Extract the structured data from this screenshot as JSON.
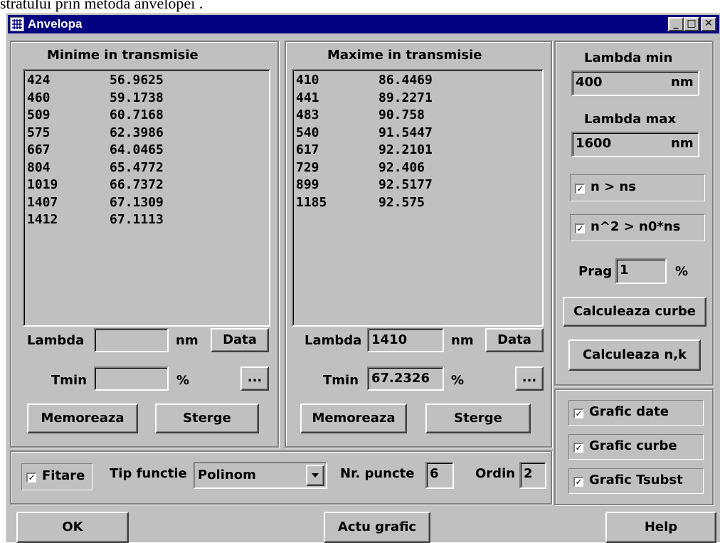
{
  "doc_caption": "stratului prin metoda anvelopei   .",
  "window": {
    "title": "Anvelopa",
    "min_icon": "minimize-icon",
    "max_icon": "maximize-icon",
    "close_icon": "close-icon"
  },
  "min_panel": {
    "title": "Minime in transmisie",
    "rows": [
      [
        "424",
        "56.9625"
      ],
      [
        "460",
        "59.1738"
      ],
      [
        "509",
        "60.7168"
      ],
      [
        "575",
        "62.3986"
      ],
      [
        "667",
        "64.0465"
      ],
      [
        "804",
        "65.4772"
      ],
      [
        "1019",
        "66.7372"
      ],
      [
        "1407",
        "67.1309"
      ],
      [
        "1412",
        "67.1113"
      ]
    ],
    "lambda_label": "Lambda",
    "lambda_value": "",
    "nm": "nm",
    "data_btn": "Data",
    "t_label": "Tmin",
    "t_value": "",
    "pct": "%",
    "more_btn": "...",
    "save_btn": "Memoreaza",
    "delete_btn": "Sterge"
  },
  "max_panel": {
    "title": "Maxime in transmisie",
    "rows": [
      [
        "410",
        "86.4469"
      ],
      [
        "441",
        "89.2271"
      ],
      [
        "483",
        "90.758"
      ],
      [
        "540",
        "91.5447"
      ],
      [
        "617",
        "92.2101"
      ],
      [
        "729",
        "92.406"
      ],
      [
        "899",
        "92.5177"
      ],
      [
        "1185",
        "92.575"
      ]
    ],
    "lambda_label": "Lambda",
    "lambda_value": "1410",
    "nm": "nm",
    "data_btn": "Data",
    "t_label": "Tmin",
    "t_value": "67.2326",
    "pct": "%",
    "more_btn": "...",
    "save_btn": "Memoreaza",
    "delete_btn": "Sterge"
  },
  "right_panel": {
    "lambda_min_label": "Lambda min",
    "lambda_min_value": "400",
    "nm": "nm",
    "lambda_max_label": "Lambda max",
    "lambda_max_value": "1600",
    "cond1": "n > ns",
    "cond2": "n^2 > n0*ns",
    "prag_label": "Prag",
    "prag_value": "1",
    "pct": "%",
    "calc_curves_btn": "Calculeaza curbe",
    "calc_nk_btn": "Calculeaza n,k"
  },
  "graph_options": {
    "data": "Grafic date",
    "curves": "Grafic curbe",
    "tsubst": "Grafic Tsubst"
  },
  "fit_bar": {
    "fit_label": "Fitare",
    "func_label": "Tip functie",
    "func_value": "Polinom",
    "points_label": "Nr. puncte",
    "points_value": "6",
    "order_label": "Ordin",
    "order_value": "2"
  },
  "bottom": {
    "ok": "OK",
    "refresh": "Actu grafic",
    "help": "Help"
  },
  "checkmark": "✓"
}
